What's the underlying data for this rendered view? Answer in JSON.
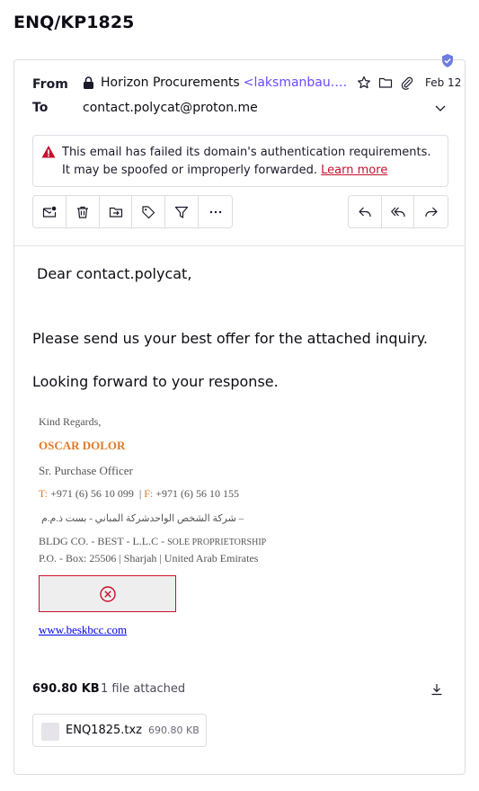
{
  "subject": "ENQ/KP1825",
  "header": {
    "from_label": "From",
    "to_label": "To",
    "sender_name": "Horizon Procurements",
    "sender_address": "<laksmanbau.meeting@…",
    "date": "Feb 12",
    "recipient": "contact.polycat@proton.me"
  },
  "banner": {
    "message": "This email has failed its domain's authentication requirements. It may be spoofed or improperly forwarded.",
    "learn_more": "Learn more"
  },
  "toolbar": {
    "left_icons": [
      "mark-unread-icon",
      "trash-icon",
      "move-icon",
      "label-icon",
      "filter-icon",
      "more-icon"
    ],
    "right_icons": [
      "reply-icon",
      "reply-all-icon",
      "forward-icon"
    ]
  },
  "body": {
    "greeting": "Dear contact.polycat,",
    "para1": "Please send us your best offer for the attached inquiry.",
    "para2": "Looking forward to your response."
  },
  "signature": {
    "regards": "Kind Regards,",
    "name": "OSCAR DOLOR",
    "title": "Sr. Purchase Officer",
    "t_label": "T:",
    "t_value": "+971 (6) 56 10 099",
    "f_label": "F:",
    "f_value": "+971 (6) 56 10 155",
    "arabic": "– شركة الشخص الواحدشركة المباني  -  بست ذ.م.م",
    "company": "BLDG CO. - BEST - L.L.C -",
    "company_type": "SOLE PROPRIETORSHIP",
    "address": "P.O. -  Box: 25506 | Sharjah | United Arab Emirates",
    "website": "www.beskbcc.com"
  },
  "attachments": {
    "total_size": "690.80 KB",
    "count_text": "1 file attached",
    "files": [
      {
        "name": "ENQ1825.txz",
        "size": "690.80 KB"
      }
    ]
  },
  "colors": {
    "accent": "#6d4aff",
    "danger": "#c8102e",
    "signature_orange": "#e07a26"
  }
}
